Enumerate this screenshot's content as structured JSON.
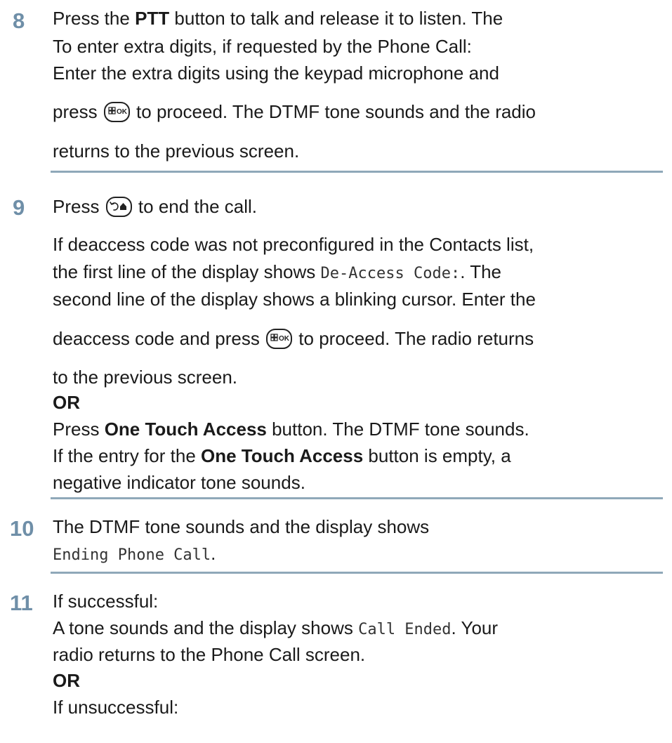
{
  "steps": [
    {
      "number": "8",
      "lines": [
        {
          "a": "Press the ",
          "b": "PTT",
          "c": " button to talk and release it to listen. The"
        },
        {
          "a": "To enter extra digits, if requested by the Phone Call:"
        },
        {
          "a": "Enter the extra digits using the keypad microphone and"
        },
        {
          "a": "press ",
          "icon": "menu-ok-key-icon",
          "c": " to proceed. The DTMF tone sounds and the radio"
        },
        {
          "a": "returns to the previous screen."
        }
      ]
    },
    {
      "number": "9",
      "lines": [
        {
          "a": "Press ",
          "icon": "back-home-key-icon",
          "c": " to end the call."
        },
        {
          "a": "If deaccess code was not preconfigured in the Contacts list,"
        },
        {
          "a": "the first line of the display shows ",
          "mono": "De-Access Code:",
          "c": ". The"
        },
        {
          "a": "second line of the display shows a blinking cursor. Enter the"
        },
        {
          "a": "deaccess code and press ",
          "icon": "menu-ok-key-icon",
          "c": " to proceed. The radio returns"
        },
        {
          "a": "to the previous screen."
        },
        {
          "b": "OR"
        },
        {
          "a": "Press ",
          "b": "One Touch Access",
          "c": " button. The DTMF tone sounds."
        },
        {
          "a": "If the entry for the ",
          "b": "One Touch Access",
          "c": " button is empty, a"
        },
        {
          "a": "negative indicator tone sounds."
        }
      ]
    },
    {
      "number": "10",
      "lines": [
        {
          "a": "The DTMF tone sounds and the display shows"
        },
        {
          "mono": "Ending Phone Call",
          "c": "."
        }
      ]
    },
    {
      "number": "11",
      "lines": [
        {
          "a": "If successful:"
        },
        {
          "a": "A tone sounds and the display shows ",
          "mono": "Call Ended",
          "c": ". Your"
        },
        {
          "a": "radio returns to the Phone Call screen."
        },
        {
          "b": "OR"
        },
        {
          "a": "If unsuccessful:"
        }
      ]
    }
  ]
}
